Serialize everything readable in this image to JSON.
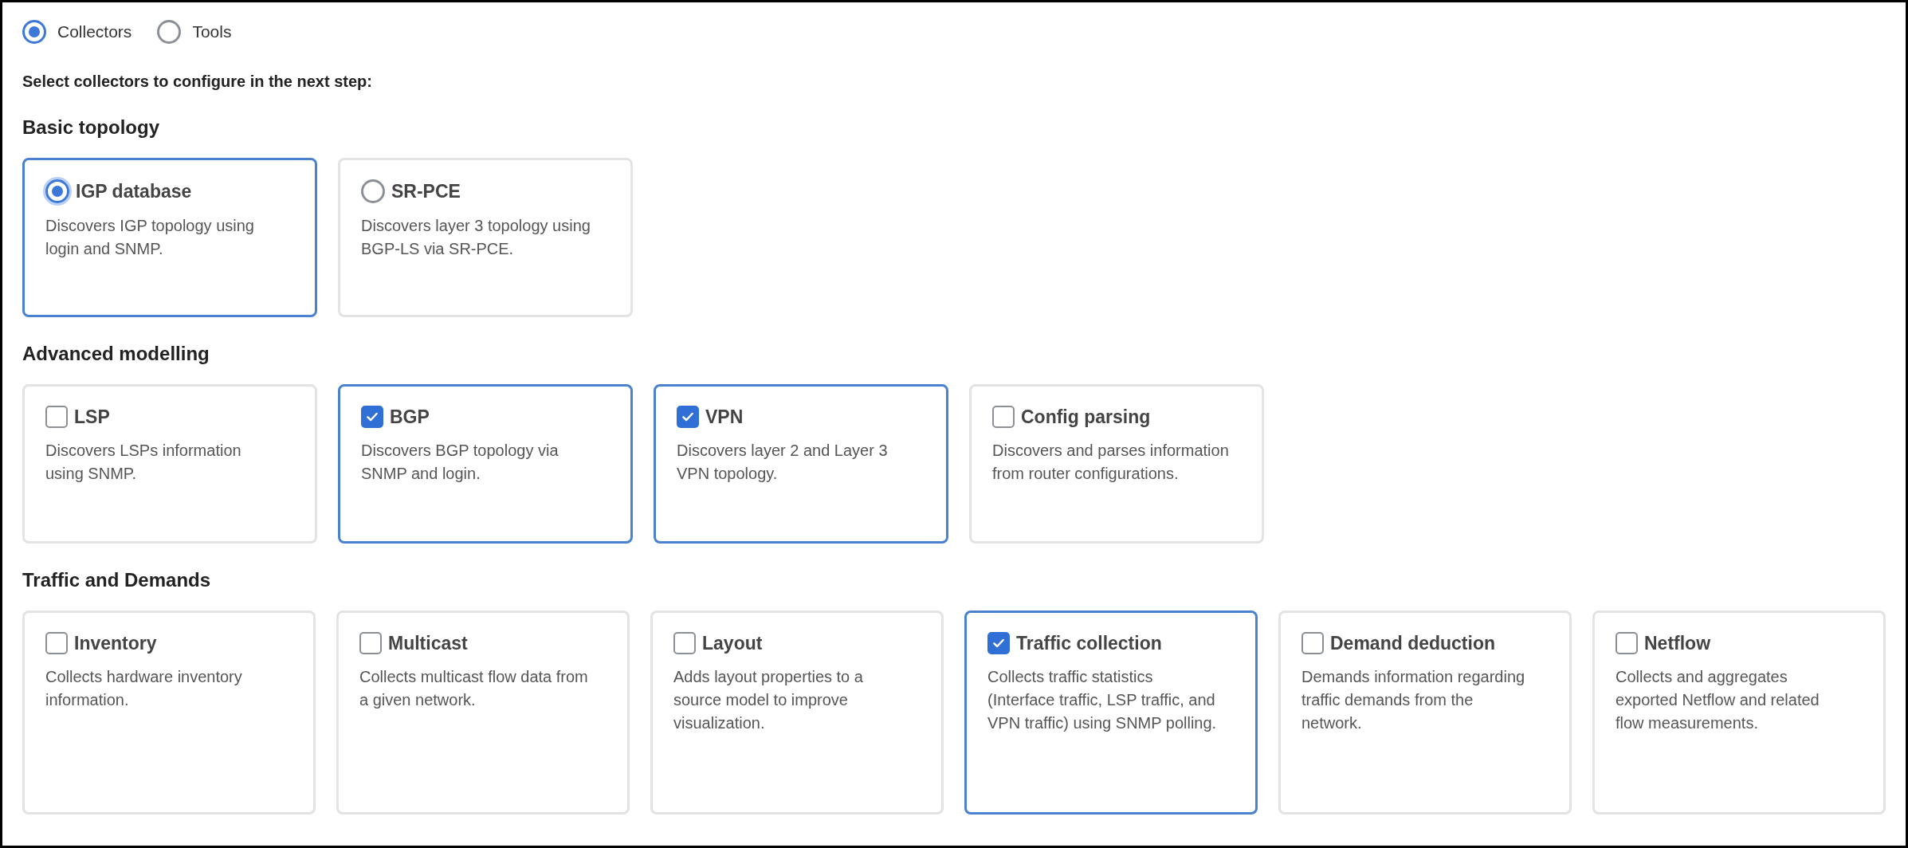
{
  "mode_options": [
    {
      "label": "Collectors",
      "selected": true
    },
    {
      "label": "Tools",
      "selected": false
    }
  ],
  "instruction": "Select collectors to configure in the next step:",
  "sections": [
    {
      "title": "Basic topology",
      "kind": "radio",
      "items": [
        {
          "title": "IGP database",
          "description": "Discovers IGP topology using login and SNMP.",
          "selected": true
        },
        {
          "title": "SR-PCE",
          "description": "Discovers layer 3 topology using BGP-LS via SR-PCE.",
          "selected": false
        }
      ]
    },
    {
      "title": "Advanced modelling",
      "kind": "checkbox",
      "items": [
        {
          "title": "LSP",
          "description": "Discovers LSPs information using SNMP.",
          "checked": false
        },
        {
          "title": "BGP",
          "description": "Discovers BGP topology via SNMP and login.",
          "checked": true
        },
        {
          "title": "VPN",
          "description": "Discovers layer 2 and Layer 3 VPN topology.",
          "checked": true
        },
        {
          "title": "Config parsing",
          "description": "Discovers and parses information from router configurations.",
          "checked": false
        }
      ]
    },
    {
      "title": "Traffic and Demands",
      "kind": "checkbox",
      "items": [
        {
          "title": "Inventory",
          "description": "Collects hardware inventory information.",
          "checked": false
        },
        {
          "title": "Multicast",
          "description": "Collects multicast flow data from a given network.",
          "checked": false
        },
        {
          "title": "Layout",
          "description": "Adds layout properties to a source model to improve visualization.",
          "checked": false
        },
        {
          "title": "Traffic collection",
          "description": "Collects traffic statistics (Interface traffic, LSP traffic, and VPN traffic) using SNMP polling.",
          "checked": true
        },
        {
          "title": "Demand deduction",
          "description": "Demands information regarding traffic demands from the network.",
          "checked": false
        },
        {
          "title": "Netflow",
          "description": "Collects and aggregates exported Netflow and related flow measurements.",
          "checked": false
        }
      ]
    }
  ]
}
